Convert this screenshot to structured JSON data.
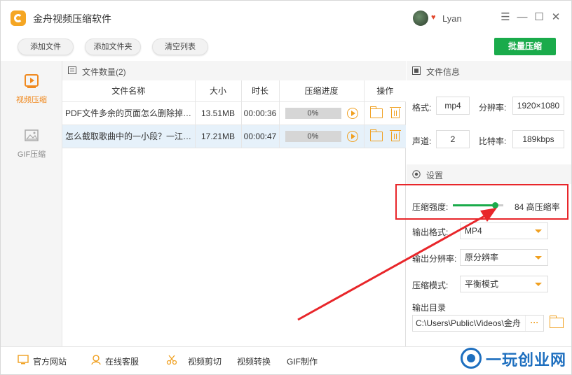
{
  "app": {
    "title": "金舟视频压缩软件",
    "user_name": "Lyan"
  },
  "window_controls": {
    "menu": "☰",
    "minimize": "—",
    "maximize": "☐",
    "close": "✕"
  },
  "toolbar": {
    "add_file": "添加文件",
    "add_folder": "添加文件夹",
    "clear_list": "清空列表",
    "batch_compress": "批量压缩"
  },
  "sidebar": {
    "items": [
      {
        "label": "视频压缩",
        "icon": "video-compress-icon",
        "active": true
      },
      {
        "label": "GIF压缩",
        "icon": "gif-compress-icon",
        "active": false
      }
    ]
  },
  "file_list": {
    "count_label": "文件数量(2)",
    "columns": [
      "文件名称",
      "大小",
      "时长",
      "压缩进度",
      "操作"
    ],
    "rows": [
      {
        "name": "PDF文件多余的页面怎么删除掉？...",
        "size": "13.51MB",
        "duration": "00:00:36",
        "progress": "0%"
      },
      {
        "name": "怎么截取歌曲中的一小段？一江下...",
        "size": "17.21MB",
        "duration": "00:00:47",
        "progress": "0%"
      }
    ]
  },
  "file_info": {
    "header": "文件信息",
    "format_label": "格式:",
    "format_value": "mp4",
    "resolution_label": "分辨率:",
    "resolution_value": "1920×1080",
    "channel_label": "声道:",
    "channel_value": "2",
    "bitrate_label": "比特率:",
    "bitrate_value": "189kbps"
  },
  "settings": {
    "header": "设置",
    "strength_label": "压缩强度:",
    "strength_value": 84,
    "strength_text": "84 高压缩率",
    "output_format_label": "输出格式:",
    "output_format_value": "MP4",
    "output_resolution_label": "输出分辨率:",
    "output_resolution_value": "原分辨率",
    "compress_mode_label": "压缩模式:",
    "compress_mode_value": "平衡模式",
    "output_dir_label": "输出目录",
    "output_dir_value": "C:\\Users\\Public\\Videos\\金舟",
    "more_label": "···"
  },
  "footer": {
    "website": "官方网站",
    "online_service": "在线客服",
    "video_cut": "视频剪切",
    "video_convert": "视频转换",
    "gif_make": "GIF制作"
  },
  "watermark": {
    "text": "一玩创业网"
  },
  "colors": {
    "accent_orange": "#f0a020",
    "accent_green": "#1aab4b",
    "highlight_red": "#e8262a",
    "selected_row": "#e6f1fa",
    "watermark_blue": "#1e6fbf"
  }
}
